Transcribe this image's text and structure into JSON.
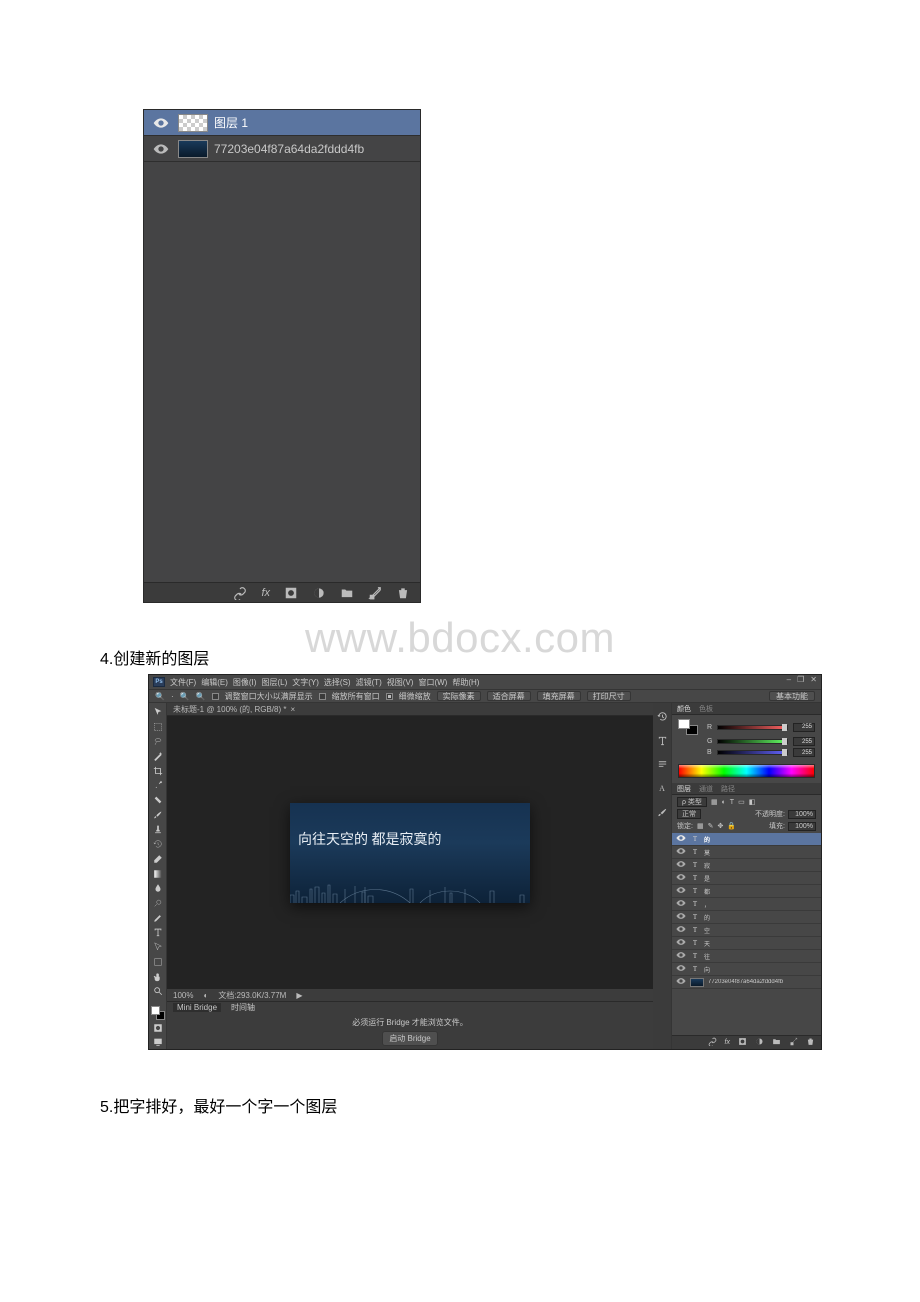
{
  "watermark": "www.bdocx.com",
  "step4": "4.创建新的图层",
  "step5": "5.把字排好，最好一个字一个图层",
  "panel1": {
    "layer_selected": "图层 1",
    "layer_bg": "77203e04f87a64da2fddd4fb",
    "footer_fx": "fx"
  },
  "ps": {
    "logo": "Ps",
    "menu": [
      "文件(F)",
      "编辑(E)",
      "图像(I)",
      "图层(L)",
      "文字(Y)",
      "选择(S)",
      "滤镜(T)",
      "视图(V)",
      "窗口(W)",
      "帮助(H)"
    ],
    "winctrls": [
      "–",
      "❐",
      "✕"
    ],
    "optbar": {
      "zoom_icon": "🔍",
      "chk1": "调整窗口大小以满屏显示",
      "chk2": "缩放所有窗口",
      "chk3": "细微缩放",
      "btn1": "实际像素",
      "btn2": "适合屏幕",
      "btn3": "填充屏幕",
      "btn4": "打印尺寸",
      "right": "基本功能"
    },
    "doctab": {
      "title": "未标题-1 @ 100% (的, RGB/8) *",
      "close": "×"
    },
    "canvas_text": "向往天空的 都是寂寞的",
    "status": {
      "zoom": "100%",
      "docinfo": "文档:293.0K/3.77M"
    },
    "bridge": {
      "tab1": "Mini Bridge",
      "tab2": "时间轴",
      "hint": "必须运行 Bridge 才能浏览文件。",
      "button": "启动 Bridge"
    },
    "mid_icons": [
      "hist",
      "char",
      "para",
      "A",
      "brush"
    ],
    "color_panel": {
      "tab_on": "颜色",
      "tab_off": "色板",
      "r": "R",
      "g": "G",
      "b": "B",
      "rv": "255",
      "gv": "255",
      "bv": "255"
    },
    "layers_panel": {
      "tab_on": "图层",
      "tab_off1": "通道",
      "tab_off2": "路径",
      "kind": "ρ 类型",
      "blend": "正常",
      "opacity_label": "不透明度:",
      "opacity_val": "100%",
      "lock_label": "锁定:",
      "fill_label": "填充:",
      "fill_val": "100%",
      "rows": [
        {
          "sel": true,
          "type": "T",
          "name": "的"
        },
        {
          "sel": false,
          "type": "T",
          "name": "莫"
        },
        {
          "sel": false,
          "type": "T",
          "name": "寂"
        },
        {
          "sel": false,
          "type": "T",
          "name": "是"
        },
        {
          "sel": false,
          "type": "T",
          "name": "都"
        },
        {
          "sel": false,
          "type": "T",
          "name": "，"
        },
        {
          "sel": false,
          "type": "T",
          "name": "的"
        },
        {
          "sel": false,
          "type": "T",
          "name": "空"
        },
        {
          "sel": false,
          "type": "T",
          "name": "天"
        },
        {
          "sel": false,
          "type": "T",
          "name": "往"
        },
        {
          "sel": false,
          "type": "T",
          "name": "向"
        },
        {
          "sel": false,
          "type": "img",
          "name": "77203e04f87a64da2fddd4fb"
        }
      ],
      "footer_fx": "fx"
    }
  }
}
